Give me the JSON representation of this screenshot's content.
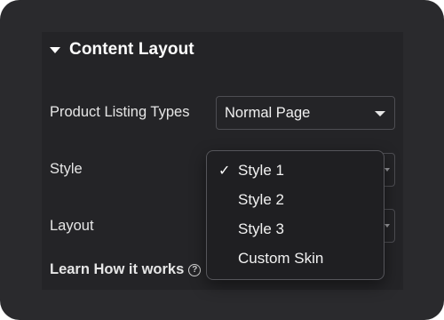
{
  "section": {
    "title": "Content Layout",
    "expanded": true
  },
  "fields": {
    "product_listing_types": {
      "label": "Product Listing Types",
      "value": "Normal Page"
    },
    "style": {
      "label": "Style",
      "value": "Style 1"
    },
    "layout": {
      "label": "Layout"
    }
  },
  "learn": {
    "text": "Learn How it works",
    "icon": "?"
  },
  "style_menu": {
    "check_mark": "✓",
    "selected_index": 0,
    "options": [
      "Style 1",
      "Style 2",
      "Style 3",
      "Custom Skin"
    ]
  },
  "colors": {
    "background": "#2a2a2d",
    "panel": "#242427",
    "menu_background": "#1f1f22",
    "text": "#e6e6e6"
  }
}
